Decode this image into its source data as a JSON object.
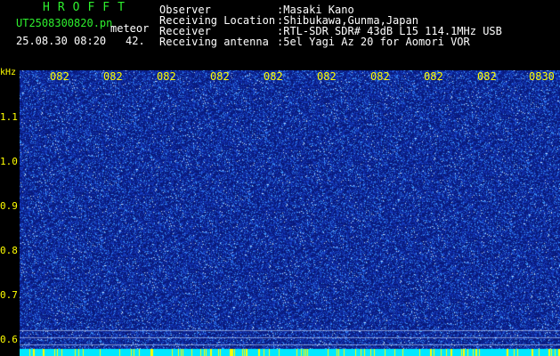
{
  "header": {
    "program": "HROFFT",
    "filename": "UT2508300820.pn",
    "mode": "meteor",
    "datetime": "25.08.30 08:20",
    "count": "42.",
    "info": [
      {
        "label": "Observer",
        "value": ":Masaki Kano"
      },
      {
        "label": "Receiving Location",
        "value": ":Shibukawa,Gunma,Japan"
      },
      {
        "label": "Receiver",
        "value": ":RTL-SDR SDR# 43dB L15 114.1MHz USB"
      },
      {
        "label": "Receiving antenna",
        "value": ":5el Yagi Az 20 for Aomori VOR"
      }
    ]
  },
  "axis": {
    "unit": "kHz",
    "y_ticks": [
      "1.1",
      "1.0",
      "0.9",
      "0.8",
      "0.7",
      "0.6"
    ],
    "x_ticks": [
      "082",
      "082",
      "082",
      "082",
      "082",
      "082",
      "082",
      "082",
      "082",
      "0830"
    ]
  },
  "colors": {
    "background": "#0a1f8c",
    "noise_dot": "#4aa0ff",
    "bright_dot": "#cfeaff",
    "label": "#ffff00",
    "title": "#2ef02e",
    "bottom_band": "#00e8ff"
  }
}
